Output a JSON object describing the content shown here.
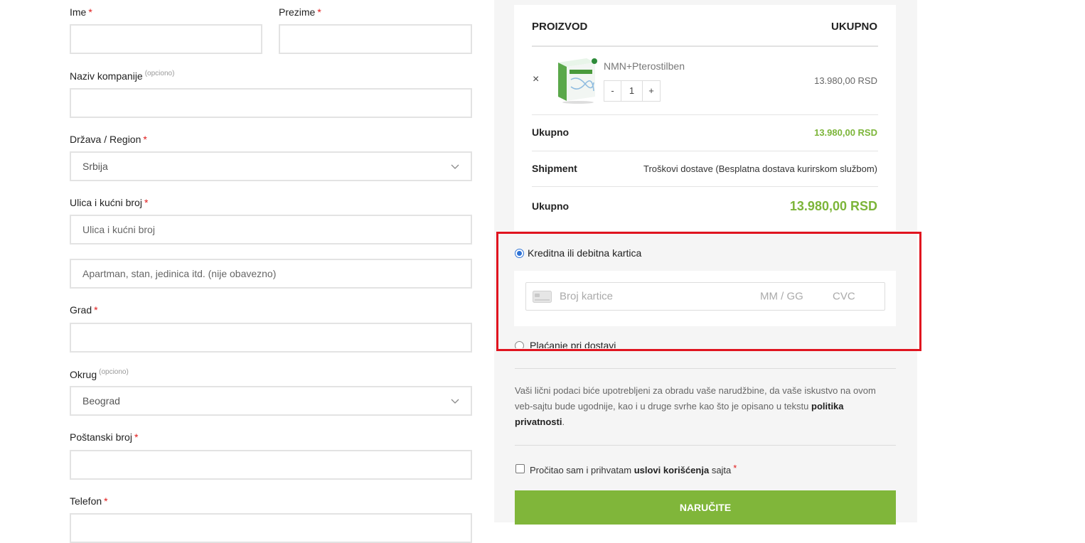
{
  "form": {
    "first_name": {
      "label": "Ime",
      "required": "*"
    },
    "last_name": {
      "label": "Prezime",
      "required": "*"
    },
    "company": {
      "label": "Naziv kompanije",
      "optional": "(opciono)"
    },
    "country": {
      "label": "Država / Region",
      "required": "*",
      "value": "Srbija"
    },
    "street": {
      "label": "Ulica i kućni broj",
      "required": "*",
      "placeholder": "Ulica i kućni broj"
    },
    "apartment": {
      "placeholder": "Apartman, stan, jedinica itd. (nije obavezno)"
    },
    "city": {
      "label": "Grad",
      "required": "*"
    },
    "district": {
      "label": "Okrug",
      "optional": "(opciono)",
      "value": "Beograd"
    },
    "postcode": {
      "label": "Poštanski broj",
      "required": "*"
    },
    "phone": {
      "label": "Telefon",
      "required": "*"
    }
  },
  "order": {
    "col_product": "PROIZVOD",
    "col_total": "UKUPNO",
    "item": {
      "remove": "×",
      "name": "NMN+Pterostilben",
      "qty_minus": "-",
      "qty": "1",
      "qty_plus": "+",
      "price": "13.980,00 RSD"
    },
    "subtotal_label": "Ukupno",
    "subtotal_value": "13.980,00 RSD",
    "shipment_label": "Shipment",
    "shipment_value": "Troškovi dostave (Besplatna dostava kurirskom službom)",
    "total_label": "Ukupno",
    "total_value": "13.980,00 RSD"
  },
  "payment": {
    "card_label": "Kreditna ili debitna kartica",
    "card_number_placeholder": "Broj kartice",
    "expiry_placeholder": "MM / GG",
    "cvc_placeholder": "CVC",
    "cod_label": "Plaćanje pri dostavi"
  },
  "privacy": {
    "text": "Vaši lični podaci biće upotrebljeni za obradu vaše narudžbine, da vaše iskustvo na ovom veb-sajtu bude ugodnije, kao i u druge svrhe kao što je opisano u tekstu",
    "link": "politika privatnosti",
    "end": "."
  },
  "terms": {
    "text": "Pročitao sam i prihvatam",
    "link": "uslovi korišćenja",
    "after": "sajta",
    "required": "*"
  },
  "order_button": "NARUČITE",
  "colors": {
    "accent_green": "#80b63a",
    "highlight_red": "#e0141f",
    "radio_blue": "#2f73d6"
  }
}
